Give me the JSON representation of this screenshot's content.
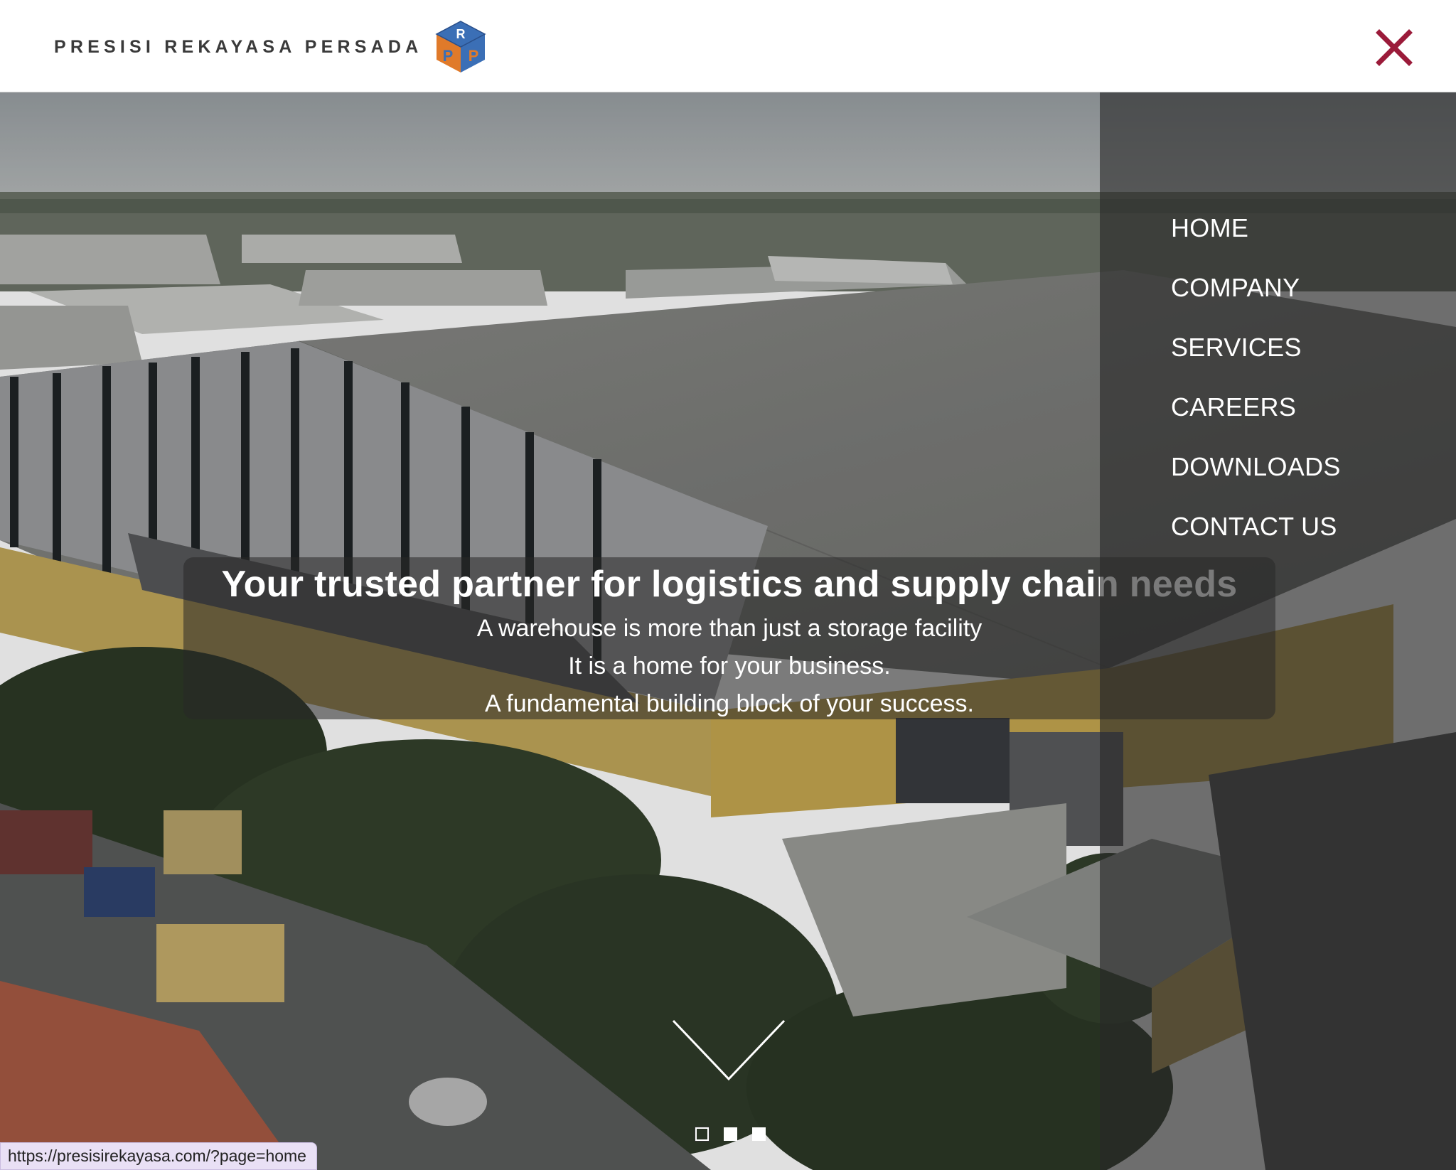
{
  "header": {
    "brand_name": "PRESISI REKAYASA PERSADA",
    "logo_letters": "PRP",
    "close_icon": "close-x-icon",
    "accent_color": "#9b1b3a"
  },
  "menu": {
    "items": [
      {
        "label": "HOME"
      },
      {
        "label": "COMPANY"
      },
      {
        "label": "SERVICES"
      },
      {
        "label": "CAREERS"
      },
      {
        "label": "DOWNLOADS"
      },
      {
        "label": "CONTACT US"
      }
    ]
  },
  "hero": {
    "headline": "Your trusted partner for logistics and supply chain needs",
    "lines": [
      "A warehouse is more than just a storage facility",
      "It is a home for your business.",
      "A fundamental building block of your success."
    ],
    "scroll_icon": "chevron-down-icon",
    "slides": {
      "total": 3,
      "active": 1
    }
  },
  "status_bar": {
    "url": "https://presisirekayasa.com/?page=home"
  }
}
